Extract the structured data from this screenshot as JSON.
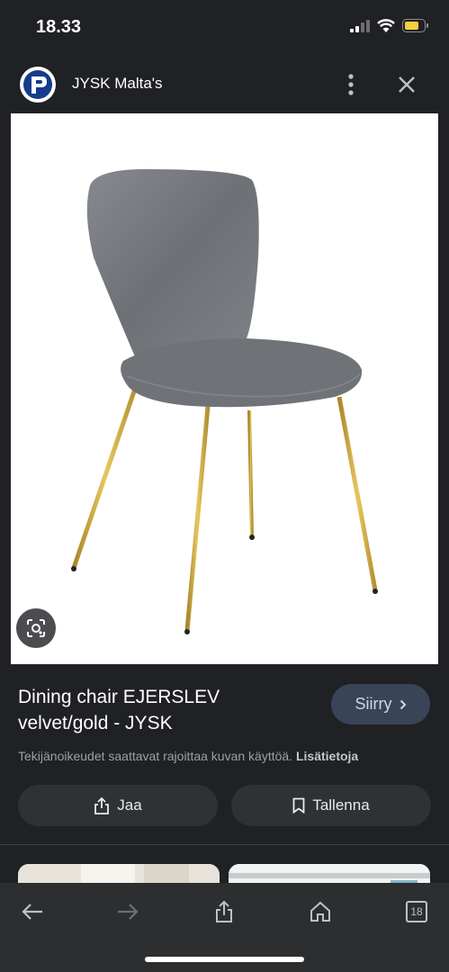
{
  "status_bar": {
    "time": "18.33"
  },
  "header": {
    "site_title": "JYSK Malta's"
  },
  "product": {
    "title_line1": "Dining chair EJERSLEV",
    "title_line2": "velvet/gold - JYSK",
    "visit_label": "Siirry"
  },
  "copyright": {
    "text": "Tekijänoikeudet saattavat rajoittaa kuvan käyttöä.",
    "link": "Lisätietoja"
  },
  "actions": {
    "share_label": "Jaa",
    "save_label": "Tallenna"
  },
  "browser": {
    "tab_count": "18"
  },
  "colors": {
    "background": "#202124",
    "accent": "#394457",
    "chair_fabric": "#7b7f84",
    "chair_legs": "#c9a53d"
  }
}
